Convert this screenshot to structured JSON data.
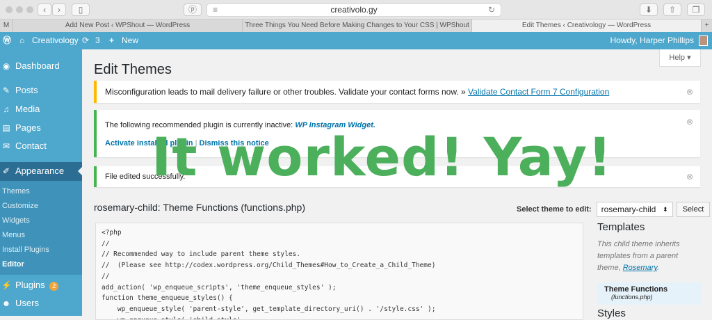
{
  "browser": {
    "url": "creativolo.gy",
    "tabs": [
      "Add New Post ‹ WPShout — WordPress",
      "Three Things You Need Before Making Changes to Your CSS | WPShout",
      "Edit Themes ‹ Creativology — WordPress"
    ]
  },
  "adminbar": {
    "site": "Creativology",
    "updates": "3",
    "new": "New",
    "howdy": "Howdy, Harper Phillips"
  },
  "sidebar": {
    "items": [
      "Dashboard",
      "Posts",
      "Media",
      "Pages",
      "Contact",
      "Appearance"
    ],
    "submenu": [
      "Themes",
      "Customize",
      "Widgets",
      "Menus",
      "Install Plugins",
      "Editor"
    ],
    "plugins": "Plugins",
    "plugins_badge": "2",
    "users": "Users"
  },
  "page": {
    "title": "Edit Themes",
    "help": "Help ▾"
  },
  "notices": {
    "n1_text": "Misconfiguration leads to mail delivery failure or other troubles. Validate your contact forms now. »",
    "n1_link": "Validate Contact Form 7 Configuration",
    "n2_text": "The following recommended plugin is currently inactive:",
    "n2_plugin": "WP Instagram Widget.",
    "n2_activate": "Activate installed plugin",
    "n2_sep": "|",
    "n2_dismiss": "Dismiss this notice",
    "n3_text": "File edited successfully."
  },
  "editor": {
    "title": "rosemary-child: Theme Functions (functions.php)",
    "select_label": "Select theme to edit:",
    "select_value": "rosemary-child",
    "select_button": "Select",
    "code": "<?php\n//\n// Recommended way to include parent theme styles.\n//  (Please see http://codex.wordpress.org/Child_Themes#How_to_Create_a_Child_Theme)\n//\nadd_action( 'wp_enqueue_scripts', 'theme_enqueue_styles' );\nfunction theme_enqueue_styles() {\n    wp_enqueue_style( 'parent-style', get_template_directory_uri() . '/style.css' );\n    wp_enqueue_style( 'child-style',\n        get_stylesheet_directory_uri() . '/style.css',"
  },
  "templates": {
    "heading": "Templates",
    "desc": "This child theme inherits templates from a parent theme,",
    "parent": "Rosemary",
    "file_title": "Theme Functions",
    "file_name": "(functions.php)",
    "styles": "Styles"
  },
  "overlay": "It worked! Yay!"
}
